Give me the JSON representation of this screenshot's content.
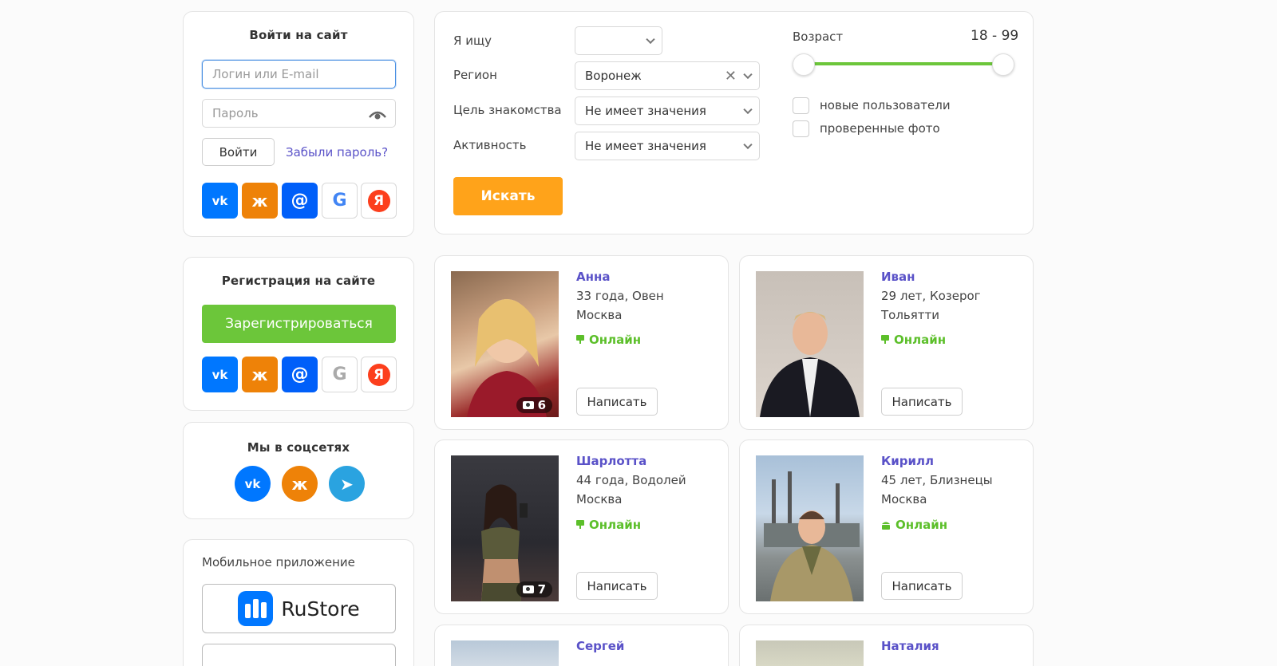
{
  "login": {
    "title": "Войти на сайт",
    "login_placeholder": "Логин или E-mail",
    "password_placeholder": "Пароль",
    "submit_label": "Войти",
    "forgot_label": "Забыли пароль?",
    "socials": [
      {
        "name": "vk",
        "glyph": "vk"
      },
      {
        "name": "ok",
        "glyph": "ж"
      },
      {
        "name": "mail",
        "glyph": "@"
      },
      {
        "name": "google",
        "glyph": "G"
      },
      {
        "name": "yandex",
        "glyph": "Я"
      }
    ]
  },
  "register": {
    "title": "Регистрация на сайте",
    "button_label": "Зарегистрироваться",
    "socials": [
      {
        "name": "vk",
        "glyph": "vk"
      },
      {
        "name": "ok",
        "glyph": "ж"
      },
      {
        "name": "mail",
        "glyph": "@"
      },
      {
        "name": "google",
        "glyph": "G"
      },
      {
        "name": "yandex",
        "glyph": "Я"
      }
    ]
  },
  "social_networks": {
    "title": "Мы в соцсетях",
    "items": [
      {
        "name": "vk",
        "glyph": "vk",
        "color": "#0077ff"
      },
      {
        "name": "ok",
        "glyph": "ж",
        "color": "#ee8208"
      },
      {
        "name": "telegram",
        "glyph": "➤",
        "color": "#2aa3e0"
      }
    ]
  },
  "mobile_app": {
    "title": "Мобильное приложение",
    "store_label": "RuStore"
  },
  "search": {
    "looking_for_label": "Я ищу",
    "looking_for_value": "",
    "region_label": "Регион",
    "region_value": "Воронеж",
    "goal_label": "Цель знакомства",
    "goal_value": "Не имеет значения",
    "activity_label": "Активность",
    "activity_value": "Не имеет значения",
    "age_label": "Возраст",
    "age_range": "18 - 99",
    "age_min": 18,
    "age_max": 99,
    "new_users_label": "новые пользователи",
    "verified_photo_label": "проверенные фото",
    "search_button_label": "Искать"
  },
  "profiles": [
    {
      "name": "Анна",
      "info": "33 года, Овен",
      "city": "Москва",
      "status": "Онлайн",
      "photos": "6",
      "message_label": "Написать"
    },
    {
      "name": "Иван",
      "info": "29 лет, Козерог",
      "city": "Тольятти",
      "status": "Онлайн",
      "photos": "",
      "message_label": "Написать"
    },
    {
      "name": "Шарлотта",
      "info": "44 года, Водолей",
      "city": "Москва",
      "status": "Онлайн",
      "photos": "7",
      "message_label": "Написать"
    },
    {
      "name": "Кирилл",
      "info": "45 лет, Близнецы",
      "city": "Москва",
      "status": "Онлайн",
      "photos": "",
      "message_label": "Написать"
    },
    {
      "name": "Сергей"
    },
    {
      "name": "Наталия"
    }
  ],
  "colors": {
    "accent_purple": "#5a52c8",
    "online_green": "#5cbf2a",
    "register_green": "#6cc63a",
    "search_orange": "#ffa31a",
    "slider_green": "#6cc63a"
  }
}
